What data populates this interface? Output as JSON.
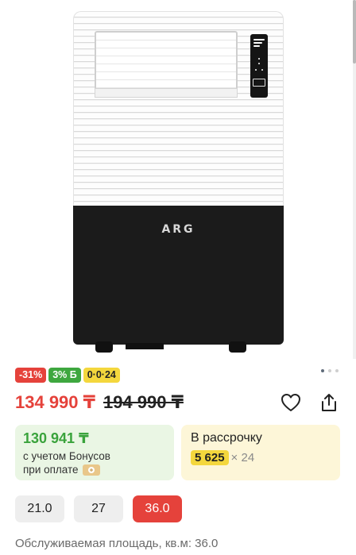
{
  "product_image": {
    "brand_logo": "ARG",
    "carousel": {
      "total": 3,
      "active": 1
    }
  },
  "badges": {
    "discount": "-31%",
    "bonus": "3% Б",
    "installment": "0·0·24"
  },
  "price": {
    "current": "134 990 ₸",
    "old": "194 990 ₸"
  },
  "actions": {
    "favorite_icon": "heart-icon",
    "share_icon": "share-icon"
  },
  "bonus_card": {
    "price": "130 941 ₸",
    "line1": "с учетом Бонусов",
    "line2": "при оплате",
    "payment_icon": "wallet-icon"
  },
  "installment_card": {
    "title": "В рассрочку",
    "amount": "5 625",
    "multiplier": "× 24"
  },
  "options": {
    "items": [
      "21.0",
      "27",
      "36.0"
    ],
    "selected": "36.0"
  },
  "area_label": "Обслуживаемая площадь, кв.м: 36.0",
  "colors": {
    "accent_red": "#e5423b",
    "bonus_green": "#3ea73f",
    "installment_yellow": "#f4d73d"
  }
}
